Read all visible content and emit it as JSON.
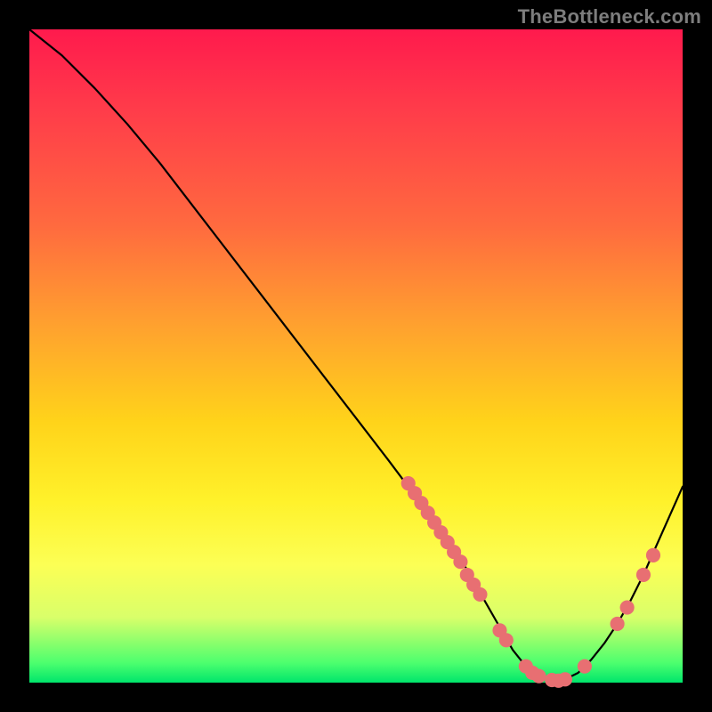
{
  "watermark": "TheBottleneck.com",
  "chart_data": {
    "type": "line",
    "title": "",
    "xlabel": "",
    "ylabel": "",
    "xlim": [
      0,
      100
    ],
    "ylim": [
      0,
      100
    ],
    "grid": false,
    "legend": false,
    "series": [
      {
        "name": "bottleneck-curve",
        "x": [
          0,
          5,
          10,
          15,
          20,
          25,
          30,
          35,
          40,
          45,
          50,
          55,
          58,
          60,
          62,
          64,
          66,
          68,
          70,
          72,
          74,
          76,
          78,
          80,
          82,
          84,
          86,
          88,
          90,
          92,
          94,
          96,
          98,
          100
        ],
        "y": [
          100,
          96,
          91,
          85.5,
          79.5,
          73,
          66.5,
          60,
          53.5,
          47,
          40.5,
          34,
          30,
          27.5,
          25,
          22,
          19,
          15.5,
          12,
          8.5,
          5,
          2.5,
          1,
          0.3,
          0.5,
          1.5,
          3.5,
          6,
          9,
          12.5,
          16.5,
          21,
          25.5,
          30
        ]
      }
    ],
    "markers": {
      "name": "data-points",
      "color": "#e86f72",
      "radius_plot_units": 1.1,
      "points": [
        {
          "x": 58,
          "y": 30.5
        },
        {
          "x": 59,
          "y": 29
        },
        {
          "x": 60,
          "y": 27.5
        },
        {
          "x": 61,
          "y": 26
        },
        {
          "x": 62,
          "y": 24.5
        },
        {
          "x": 63,
          "y": 23
        },
        {
          "x": 64,
          "y": 21.5
        },
        {
          "x": 65,
          "y": 20
        },
        {
          "x": 66,
          "y": 18.5
        },
        {
          "x": 67,
          "y": 16.5
        },
        {
          "x": 68,
          "y": 15
        },
        {
          "x": 69,
          "y": 13.5
        },
        {
          "x": 72,
          "y": 8
        },
        {
          "x": 73,
          "y": 6.5
        },
        {
          "x": 76,
          "y": 2.5
        },
        {
          "x": 77,
          "y": 1.5
        },
        {
          "x": 78,
          "y": 1
        },
        {
          "x": 80,
          "y": 0.4
        },
        {
          "x": 81,
          "y": 0.3
        },
        {
          "x": 82,
          "y": 0.5
        },
        {
          "x": 85,
          "y": 2.5
        },
        {
          "x": 90,
          "y": 9
        },
        {
          "x": 91.5,
          "y": 11.5
        },
        {
          "x": 94,
          "y": 16.5
        },
        {
          "x": 95.5,
          "y": 19.5
        }
      ]
    }
  }
}
